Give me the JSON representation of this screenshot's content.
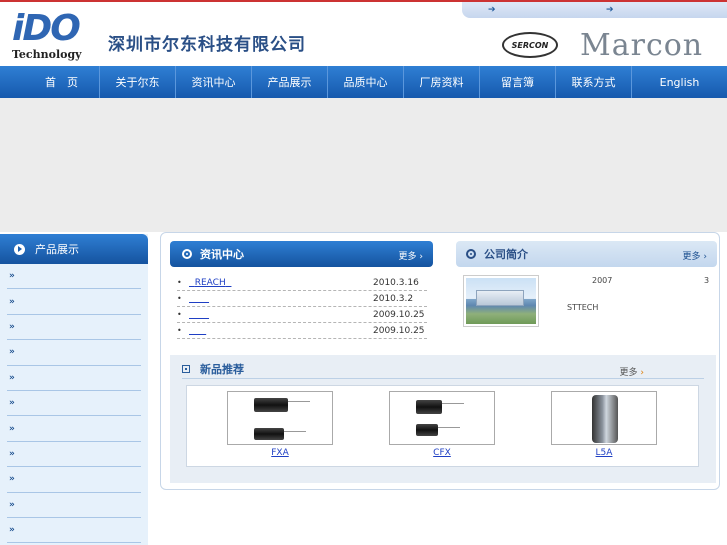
{
  "header": {
    "logo_mark": "iDO",
    "logo_sub": "Technology",
    "company_name": "深圳市尔东科技有限公司",
    "brand_left": "SERCON",
    "brand_right": "Marcon",
    "top_arrows": [
      "➔",
      "➔"
    ]
  },
  "nav": {
    "items": [
      {
        "label": "首　页"
      },
      {
        "label": "关于尔东"
      },
      {
        "label": "资讯中心"
      },
      {
        "label": "产品展示"
      },
      {
        "label": "品质中心"
      },
      {
        "label": "厂房资料"
      },
      {
        "label": "留言簿"
      },
      {
        "label": "联系方式"
      },
      {
        "label": "English"
      }
    ]
  },
  "sidebar": {
    "title": "产品展示",
    "items": [
      "»",
      "»",
      "»",
      "»",
      "»",
      "»",
      "»",
      "»",
      "»",
      "»",
      "»"
    ]
  },
  "news": {
    "title": "资讯中心",
    "more": "更多",
    "items": [
      {
        "title": "REACH",
        "date": "2010.3.16"
      },
      {
        "title": "",
        "date": "2010.3.2"
      },
      {
        "title": "",
        "date": "2009.10.25"
      },
      {
        "title": "",
        "date": "2009.10.25"
      }
    ]
  },
  "about": {
    "title": "公司简介",
    "more": "更多",
    "text_year": "2007",
    "text_num": "3",
    "text_brand": "STTECH"
  },
  "new_products": {
    "title": "新品推荐",
    "more": "更多",
    "items": [
      {
        "label": "FXA"
      },
      {
        "label": "CFX"
      },
      {
        "label": "L5A"
      }
    ]
  }
}
